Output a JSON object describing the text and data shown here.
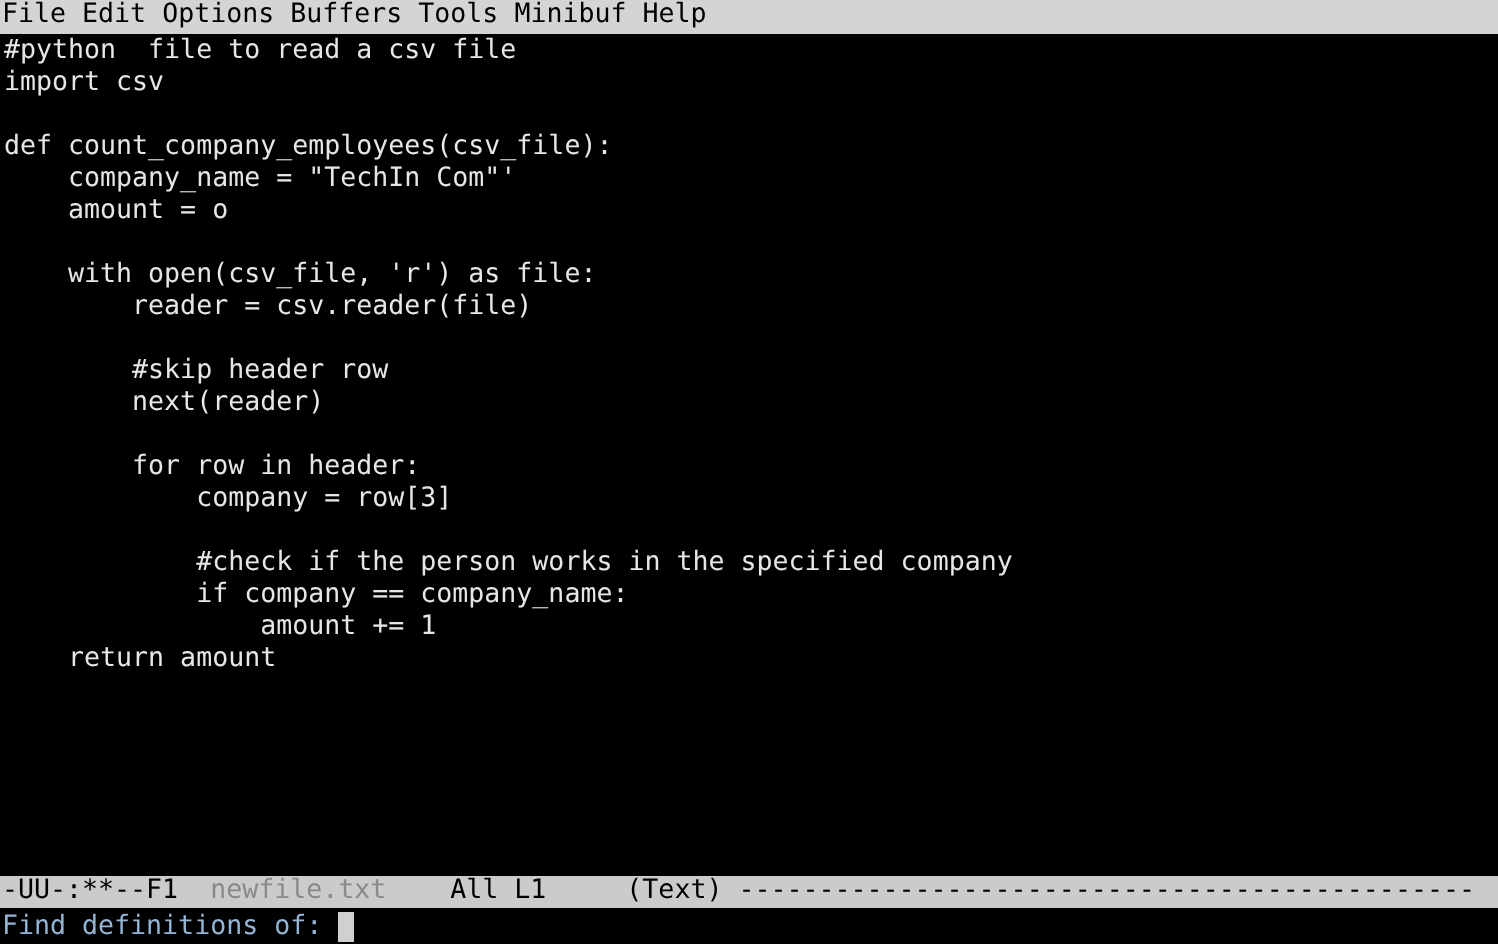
{
  "menu_bar": {
    "items": [
      "File",
      "Edit",
      "Options",
      "Buffers",
      "Tools",
      "Minibuf",
      "Help"
    ]
  },
  "buffer": {
    "blocks": [
      [
        "#python  file to read a csv file",
        "import csv"
      ],
      [
        "def count_company_employees(csv_file):",
        "    company_name = \"TechIn Com\"'",
        "    amount = o"
      ],
      [
        "    with open(csv_file, 'r') as file:",
        "        reader = csv.reader(file)"
      ],
      [
        "        #skip header row",
        "        next(reader)"
      ],
      [
        "        for row in header:",
        "            company = row[3]"
      ],
      [
        "            #check if the person works in the specified company",
        "            if company == company_name:",
        "                amount += 1",
        "    return amount"
      ]
    ]
  },
  "mode_line": {
    "status": "-UU-:**--F1",
    "buffer_name": "newfile.txt",
    "position": "All L1",
    "mode": "(Text)",
    "fill": "----------------------------------------------"
  },
  "minibuffer": {
    "prompt": "Find definitions of:"
  }
}
